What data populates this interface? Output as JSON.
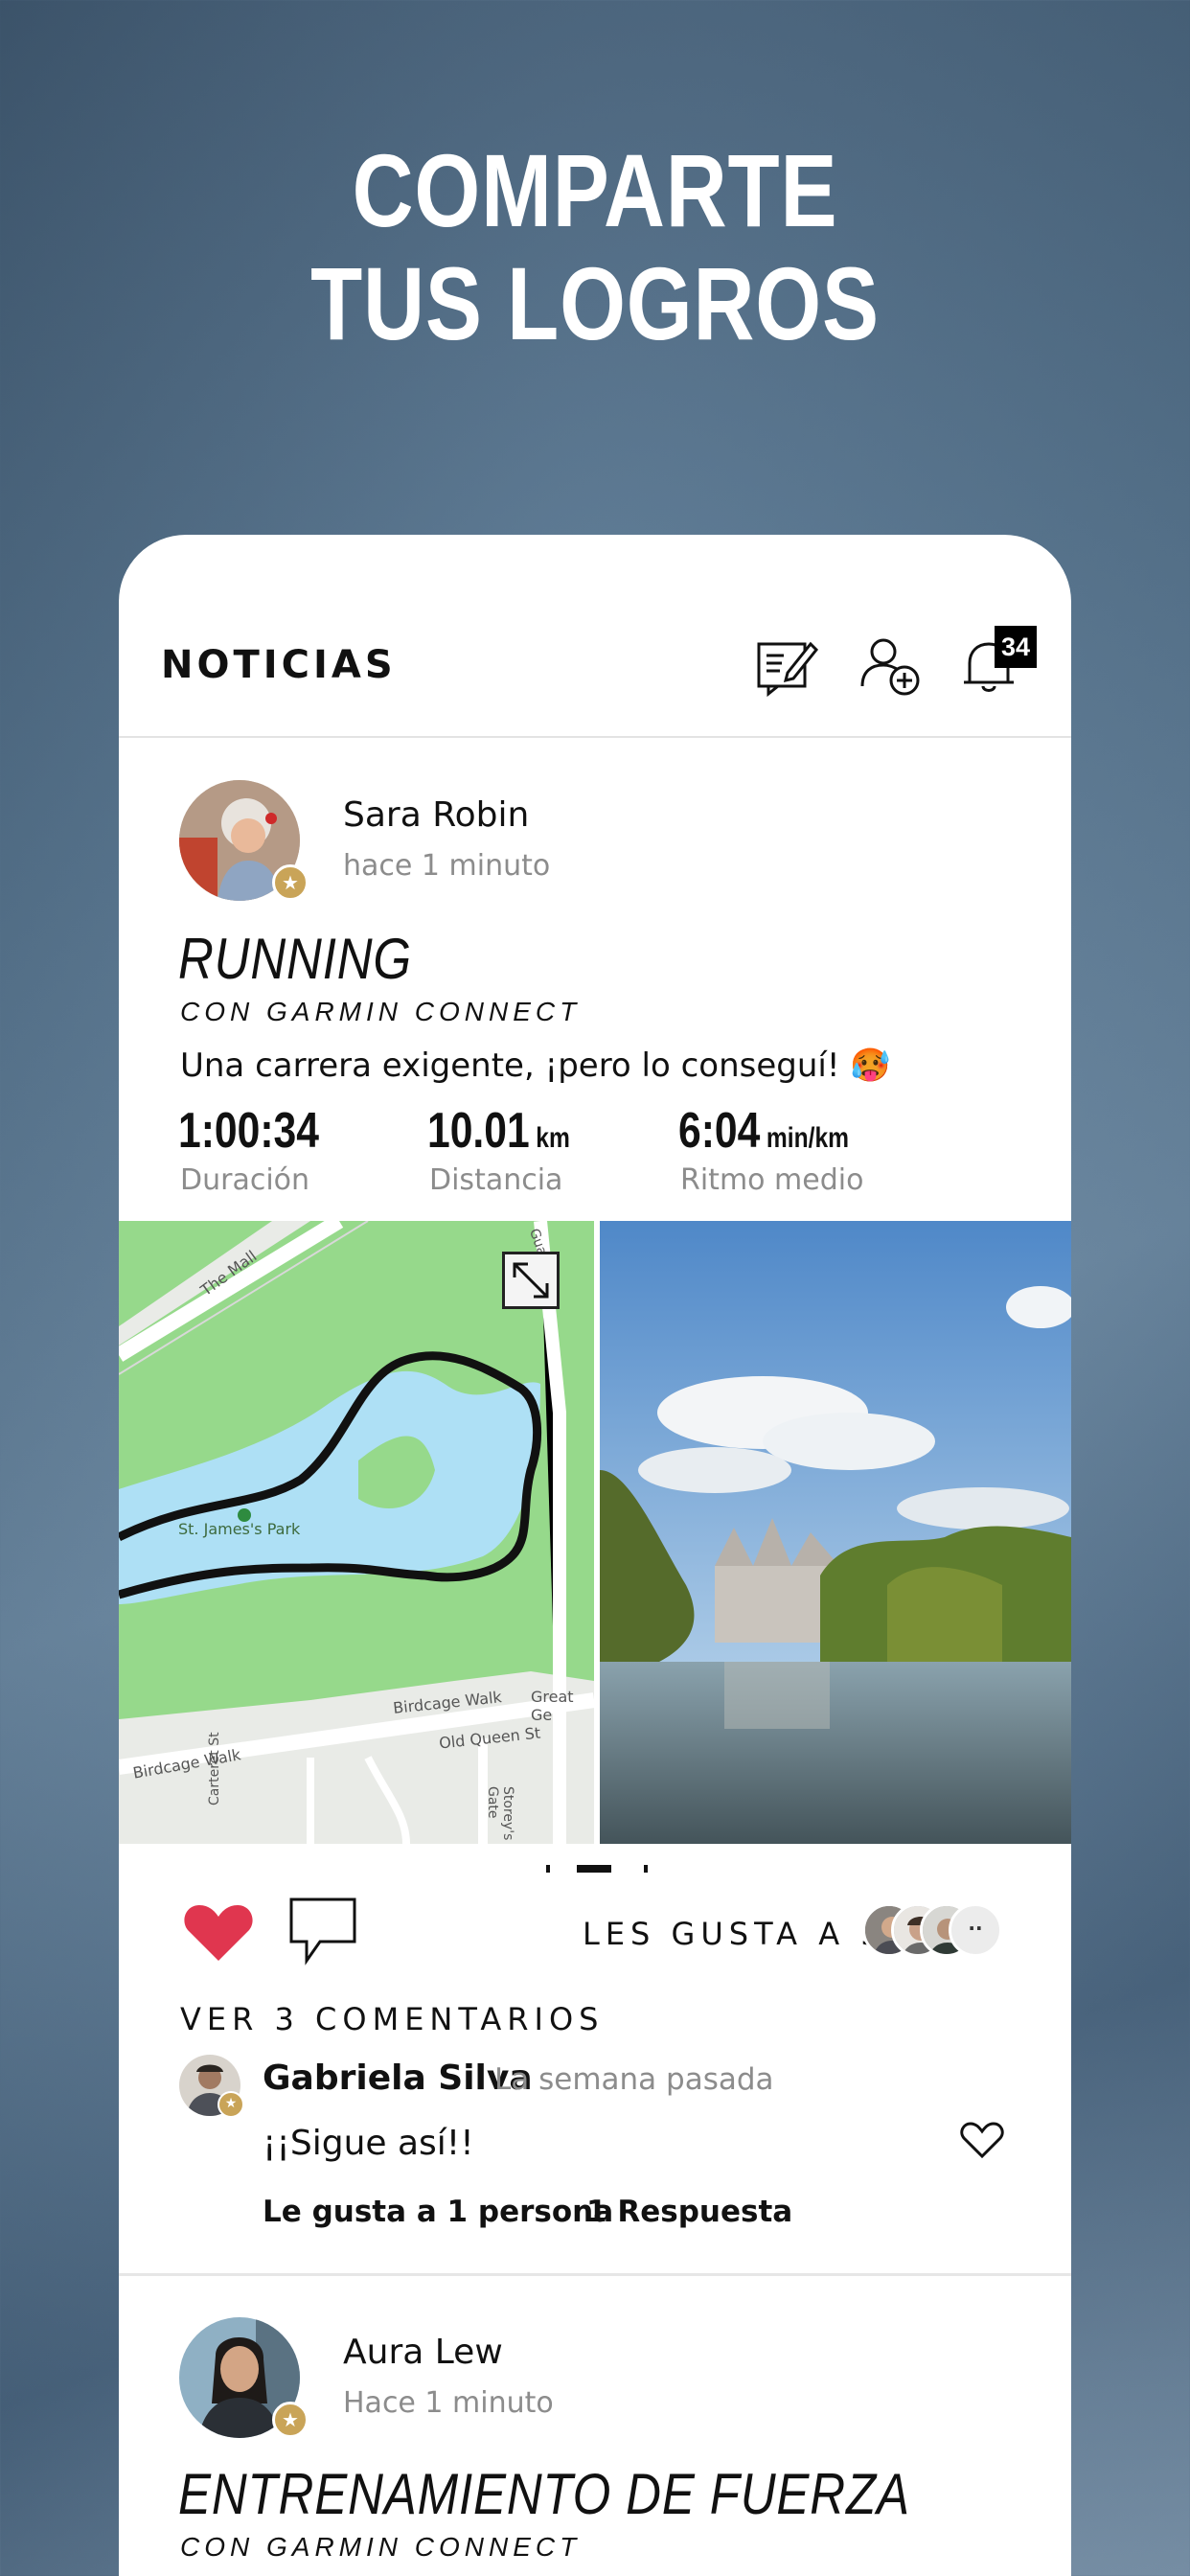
{
  "headline": {
    "line1": "COMPARTE",
    "line2": "TUS LOGROS"
  },
  "topbar": {
    "title": "NOTICIAS",
    "icons": [
      "compose-icon",
      "add-friend-icon",
      "bell-icon"
    ],
    "notification_count": "34"
  },
  "post": {
    "author": "Sara Robin",
    "time": "hace 1 minuto",
    "activity": "RUNNING",
    "source": "CON GARMIN CONNECT",
    "description": "Una carrera exigente, ¡pero lo conseguí! 🥵",
    "stats": [
      {
        "value": "1:00:34",
        "unit": "",
        "label": "Duración"
      },
      {
        "value": "10.01",
        "unit": "km",
        "label": "Distancia"
      },
      {
        "value": "6:04",
        "unit": "min/km",
        "label": "Ritmo medio"
      }
    ],
    "map_labels": {
      "mall": "The Mall",
      "park": "St. James's Park",
      "birdcage1": "Birdcage Walk",
      "birdcage2": "Birdcage Walk",
      "great": "Great Ge",
      "old_queen": "Old Queen St",
      "carteret": "Carteret St",
      "storeys": "Storey's Gate",
      "guard": "Guard"
    },
    "likes_text": "LES GUSTA A 5",
    "more_likers": "··",
    "view_comments": "VER 3 COMENTARIOS",
    "comment": {
      "author": "Gabriela Silva",
      "time": "La semana pasada",
      "text": "¡¡Sigue así!!",
      "likes": "Le gusta a 1 persona",
      "replies": "1 Respuesta"
    }
  },
  "post2": {
    "author": "Aura Lew",
    "time": "Hace 1 minuto",
    "activity": "ENTRENAMIENTO DE FUERZA",
    "source": "CON GARMIN CONNECT"
  },
  "colors": {
    "heart": "#e0364f",
    "badge_gold": "#c9a458",
    "route": "#111111",
    "water": "#aee0f5",
    "park": "#96d98b"
  }
}
